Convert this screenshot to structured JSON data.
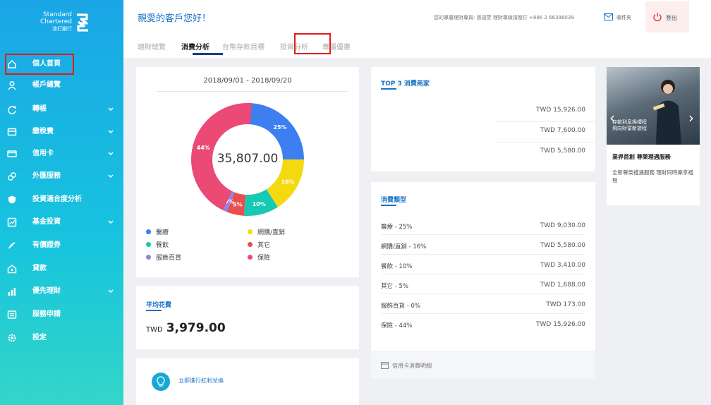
{
  "brand": {
    "name_line1": "Standard",
    "name_line2": "Chartered",
    "name_line3": "渣打銀行"
  },
  "sidebar": {
    "items": [
      {
        "label": "個人首頁",
        "icon": "home-icon",
        "has_chevron": false
      },
      {
        "label": "帳戶總覽",
        "icon": "user-icon",
        "has_chevron": false
      },
      {
        "label": "轉帳",
        "icon": "transfer-icon",
        "has_chevron": true
      },
      {
        "label": "繳稅費",
        "icon": "bill-icon",
        "has_chevron": true
      },
      {
        "label": "信用卡",
        "icon": "credit-card-icon",
        "has_chevron": true
      },
      {
        "label": "外匯服務",
        "icon": "fx-icon",
        "has_chevron": true
      },
      {
        "label": "投資適合度分析",
        "icon": "shield-icon",
        "has_chevron": false
      },
      {
        "label": "基金投資",
        "icon": "fund-icon",
        "has_chevron": true
      },
      {
        "label": "有價證券",
        "icon": "securities-icon",
        "has_chevron": false
      },
      {
        "label": "貸款",
        "icon": "loan-icon",
        "has_chevron": false
      },
      {
        "label": "優先理財",
        "icon": "chart-icon",
        "has_chevron": true
      },
      {
        "label": "服務申請",
        "icon": "application-icon",
        "has_chevron": false
      },
      {
        "label": "設定",
        "icon": "gear-icon",
        "has_chevron": false
      }
    ]
  },
  "header": {
    "greeting": "親愛的客戶您好！",
    "notice": "您的專屬理財專員: 張語萱 理財專線請撥打 +886 2 66396039",
    "inbox_label": "收件夾",
    "logout_label": "登出"
  },
  "tabs": [
    {
      "label": "理財總覽",
      "active": false
    },
    {
      "label": "消費分析",
      "active": true
    },
    {
      "label": "台幣存款目標",
      "active": false
    },
    {
      "label": "投資分析",
      "active": false
    },
    {
      "label": "專屬優惠",
      "active": false
    }
  ],
  "spending": {
    "date_range": "2018/09/01 - 2018/09/20",
    "total": "35,807.00",
    "legend": [
      {
        "label": "醫療",
        "color": "#3d7ef0"
      },
      {
        "label": "網購/直銷",
        "color": "#f5d90f"
      },
      {
        "label": "餐飲",
        "color": "#17c9b3"
      },
      {
        "label": "其它",
        "color": "#ea4d4d"
      },
      {
        "label": "服飾百貨",
        "color": "#8f84e0"
      },
      {
        "label": "保險",
        "color": "#ea4a74"
      }
    ]
  },
  "chart_data": {
    "type": "pie",
    "title": "",
    "categories": [
      "醫療",
      "網購/直銷",
      "餐飲",
      "其它",
      "服飾百貨",
      "保險"
    ],
    "values": [
      25,
      16,
      10,
      5,
      0,
      44
    ],
    "labels": [
      "25%",
      "16%",
      "10%",
      "5%",
      "0%",
      "44%"
    ],
    "colors": [
      "#3d7ef0",
      "#f5d90f",
      "#17c9b3",
      "#ea4d4d",
      "#8f84e0",
      "#ea4a74"
    ]
  },
  "average": {
    "title": "平均花費",
    "currency": "TWD",
    "value": "3,979.00"
  },
  "promo": {
    "label": "立即進行紅利兌換"
  },
  "top3": {
    "title": "TOP 3 消費商家",
    "rows": [
      "TWD 15,926.00",
      "TWD 7,600.00",
      "TWD 5,580.00"
    ]
  },
  "categories": {
    "title": "消費類型",
    "rows": [
      {
        "name": "醫療 - 25%",
        "value": "TWD 9,030.00"
      },
      {
        "name": "網購/直銷 - 16%",
        "value": "TWD 5,580.00"
      },
      {
        "name": "餐飲 - 10%",
        "value": "TWD 3,410.00"
      },
      {
        "name": "其它 - 5%",
        "value": "TWD 1,688.00"
      },
      {
        "name": "服飾百貨 - 0%",
        "value": "TWD 173.00"
      },
      {
        "name": "保險 - 44%",
        "value": "TWD 15,926.00"
      }
    ],
    "statement_label": "信用卡消費明細"
  },
  "banner": {
    "caption_line1": "存款利息換禮程",
    "caption_line2": "飛向財富新旅程",
    "title": "業界首創 尊榮理遇服務",
    "desc": "全新尊榮禮遇服務 理財同時樂享禮程"
  }
}
